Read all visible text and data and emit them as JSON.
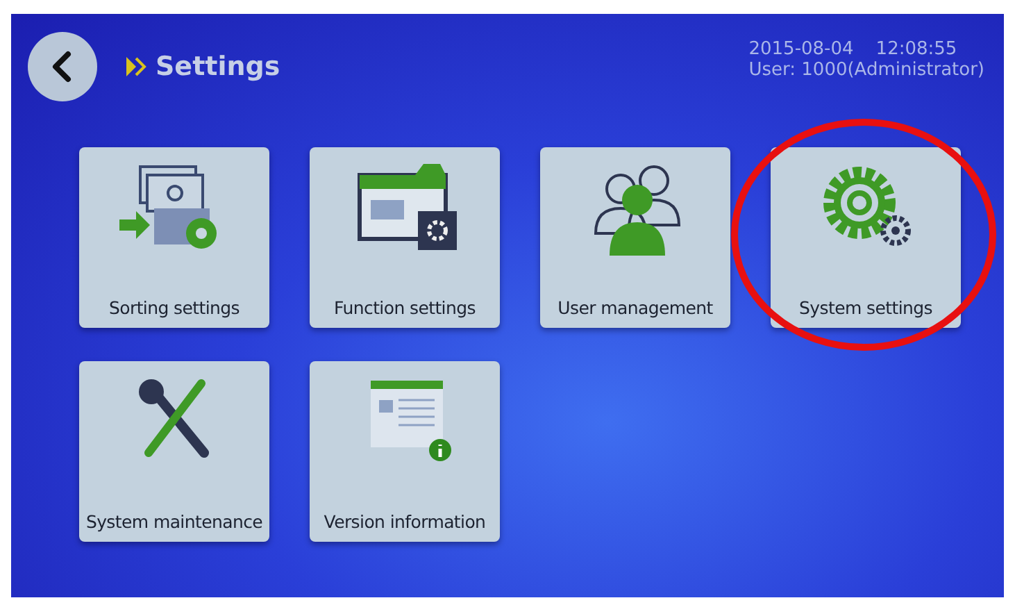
{
  "header": {
    "title": "Settings",
    "date": "2015-08-04",
    "time": "12:08:55",
    "user": "User: 1000(Administrator)"
  },
  "tiles": [
    {
      "kind": "sorting",
      "label": "Sorting settings",
      "highlighted": false
    },
    {
      "kind": "function",
      "label": "Function settings",
      "highlighted": false
    },
    {
      "kind": "users",
      "label": "User management",
      "highlighted": false
    },
    {
      "kind": "system",
      "label": "System settings",
      "highlighted": true
    },
    {
      "kind": "maintenance",
      "label": "System maintenance",
      "highlighted": false
    },
    {
      "kind": "version",
      "label": "Version information",
      "highlighted": false
    }
  ]
}
